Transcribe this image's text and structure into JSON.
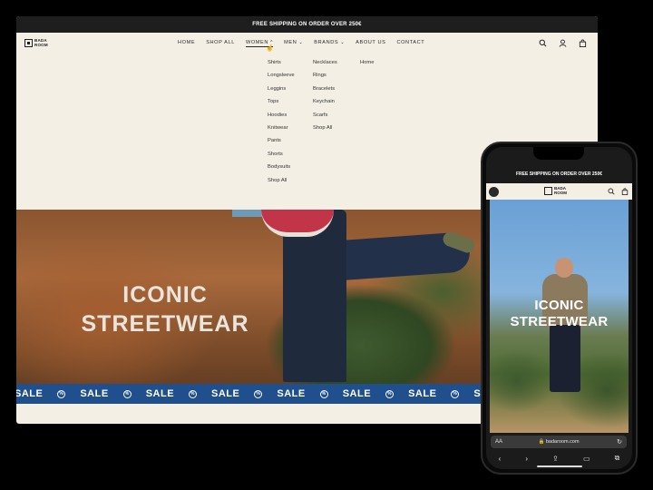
{
  "desktop": {
    "announcement": "FREE SHIPPING ON ORDER OVER 250€",
    "logo": {
      "line1": "BADA",
      "line2": "ROOM"
    },
    "nav": [
      {
        "label": "HOME"
      },
      {
        "label": "SHOP ALL"
      },
      {
        "label": "WOMEN",
        "chevron": "^"
      },
      {
        "label": "MEN",
        "chevron": "⌄"
      },
      {
        "label": "BRANDS",
        "chevron": "⌄"
      },
      {
        "label": "ABOUT US"
      },
      {
        "label": "CONTACT"
      }
    ],
    "mega_menu": {
      "col1": [
        "Shirts",
        "Longsleeve",
        "Leggins",
        "Tops",
        "Hoodies",
        "Knitwear",
        "Pants",
        "Shorts",
        "Bodysuits",
        "Shop All"
      ],
      "col2": [
        "Necklaces",
        "Rings",
        "Bracelets",
        "Keychain",
        "Scarfs",
        "Shop All"
      ],
      "col3": [
        "Home"
      ]
    },
    "hero": {
      "line1": "ICONIC",
      "line2": "STREETWEAR"
    },
    "ticker": [
      "SALE",
      "SALE",
      "SALE",
      "SALE",
      "SALE",
      "SALE",
      "SALE",
      "SALE"
    ]
  },
  "phone": {
    "announcement": "FREE SHIPPING ON ORDER OVER 250€",
    "logo": {
      "line1": "BADA",
      "line2": "ROOM"
    },
    "hero": {
      "line1": "ICONIC",
      "line2": "STREETWEAR"
    },
    "url_bar": {
      "aa": "AA",
      "url": "🔒 badaroom.com",
      "reload": "↻"
    },
    "toolbar": {
      "back": "‹",
      "forward": "›",
      "share": "⇪",
      "bookmarks": "▭",
      "tabs": "⧉"
    }
  },
  "colors": {
    "page_bg": "#f4efe4",
    "ticker": "#1f4f8c",
    "announcement_bar": "#1e1e1e"
  }
}
